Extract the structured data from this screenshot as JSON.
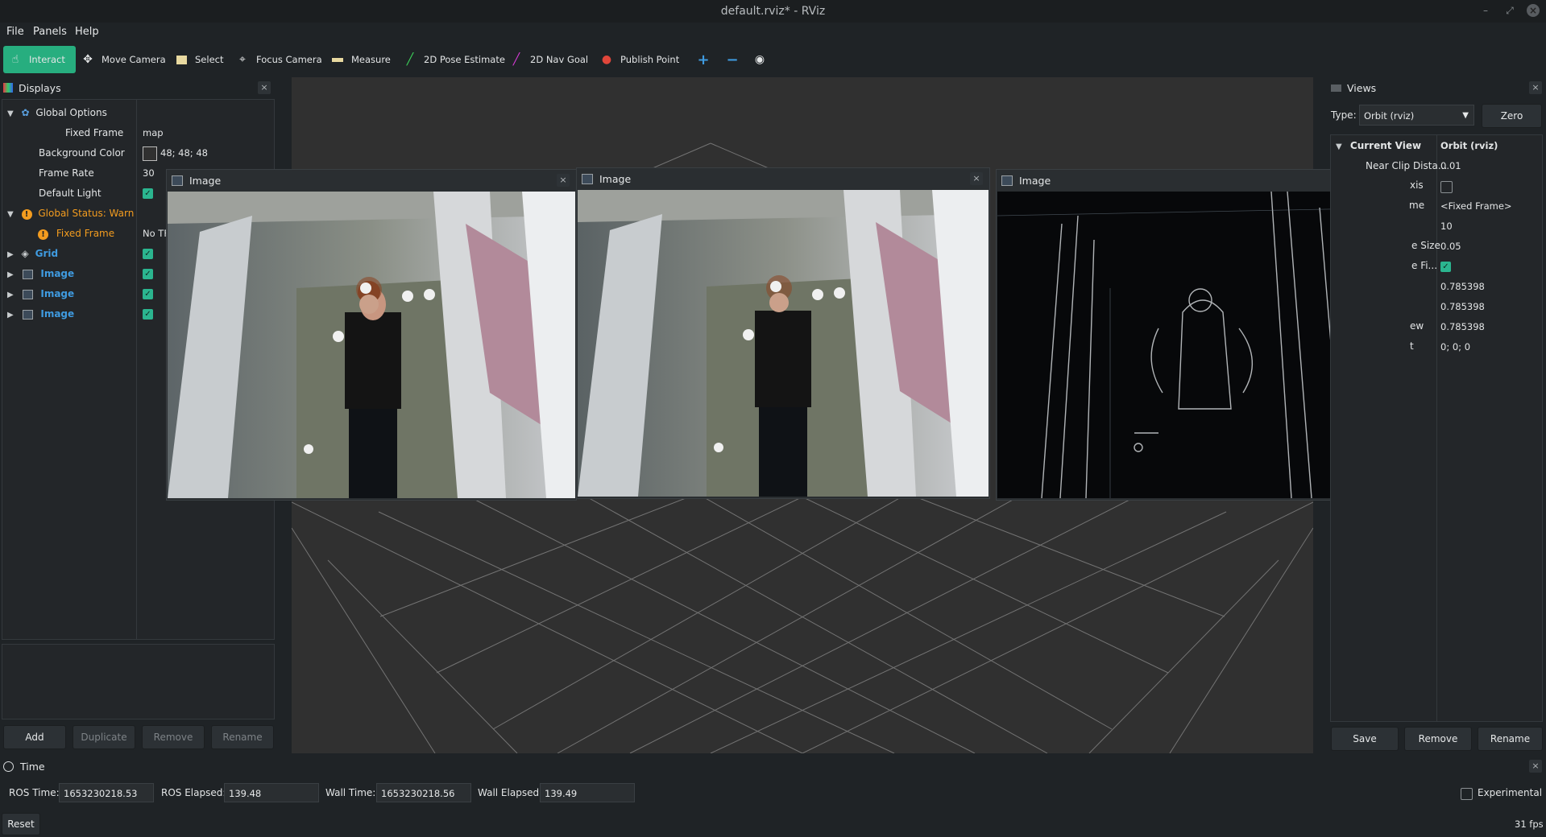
{
  "window": {
    "title": "default.rviz* - RViz"
  },
  "menu": [
    "File",
    "Panels",
    "Help"
  ],
  "toolbar": {
    "tools": [
      "Interact",
      "Move Camera",
      "Select",
      "Focus Camera",
      "Measure",
      "2D Pose Estimate",
      "2D Nav Goal",
      "Publish Point"
    ],
    "active": "Interact",
    "icons": [
      "cursor-hand-icon",
      "move-arrows-icon",
      "select-rect-icon",
      "crosshair-icon",
      "ruler-icon",
      "green-arrow-icon",
      "magenta-arrow-icon",
      "map-pin-icon",
      "plus-icon",
      "minus-icon",
      "eye-icon"
    ]
  },
  "displays": {
    "title": "Displays",
    "global_options": "Global Options",
    "props": [
      {
        "label": "Fixed Frame",
        "value": "map"
      },
      {
        "label": "Background Color",
        "value": "48; 48; 48"
      },
      {
        "label": "Frame Rate",
        "value": "30"
      },
      {
        "label": "Default Light",
        "value": ""
      }
    ],
    "global_status": "Global Status: Warn",
    "fixed_frame_status": {
      "label": "Fixed Frame",
      "value": "No TF"
    },
    "items": [
      "Grid",
      "Image",
      "Image",
      "Image"
    ],
    "buttons": [
      "Add",
      "Duplicate",
      "Remove",
      "Rename"
    ]
  },
  "image_windows": [
    {
      "title": "Image"
    },
    {
      "title": "Image"
    },
    {
      "title": "Image"
    }
  ],
  "views": {
    "title": "Views",
    "type_label": "Type:",
    "type_value": "Orbit (rviz)",
    "zero_label": "Zero",
    "current_view": "Current View",
    "current_view_value": "Orbit (rviz)",
    "props": [
      {
        "label": "Near Clip Dista...",
        "value": "0.01"
      },
      {
        "label": "xis",
        "value": ""
      },
      {
        "label": "me",
        "value": "<Fixed Frame>"
      },
      {
        "label": "",
        "value": "10"
      },
      {
        "label": "e Size",
        "value": "0.05"
      },
      {
        "label": "e Fi...",
        "value": ""
      },
      {
        "label": "",
        "value": "0.785398"
      },
      {
        "label": "",
        "value": "0.785398"
      },
      {
        "label": "ew",
        "value": "0.785398"
      },
      {
        "label": "t",
        "value": "0; 0; 0"
      }
    ],
    "buttons": [
      "Save",
      "Remove",
      "Rename"
    ]
  },
  "time": {
    "title": "Time",
    "ros_time_label": "ROS Time:",
    "ros_time": "1653230218.53",
    "ros_elapsed_label": "ROS Elapsed:",
    "ros_elapsed": "139.48",
    "wall_time_label": "Wall Time:",
    "wall_time": "1653230218.56",
    "wall_elapsed_label": "Wall Elapsed:",
    "wall_elapsed": "139.49",
    "experimental_label": "Experimental",
    "reset_label": "Reset",
    "fps": "31 fps"
  },
  "colors": {
    "accent": "#27ae7f",
    "warn": "#f39c1f",
    "link": "#3f9be0",
    "viewport_bg": "#303030"
  }
}
